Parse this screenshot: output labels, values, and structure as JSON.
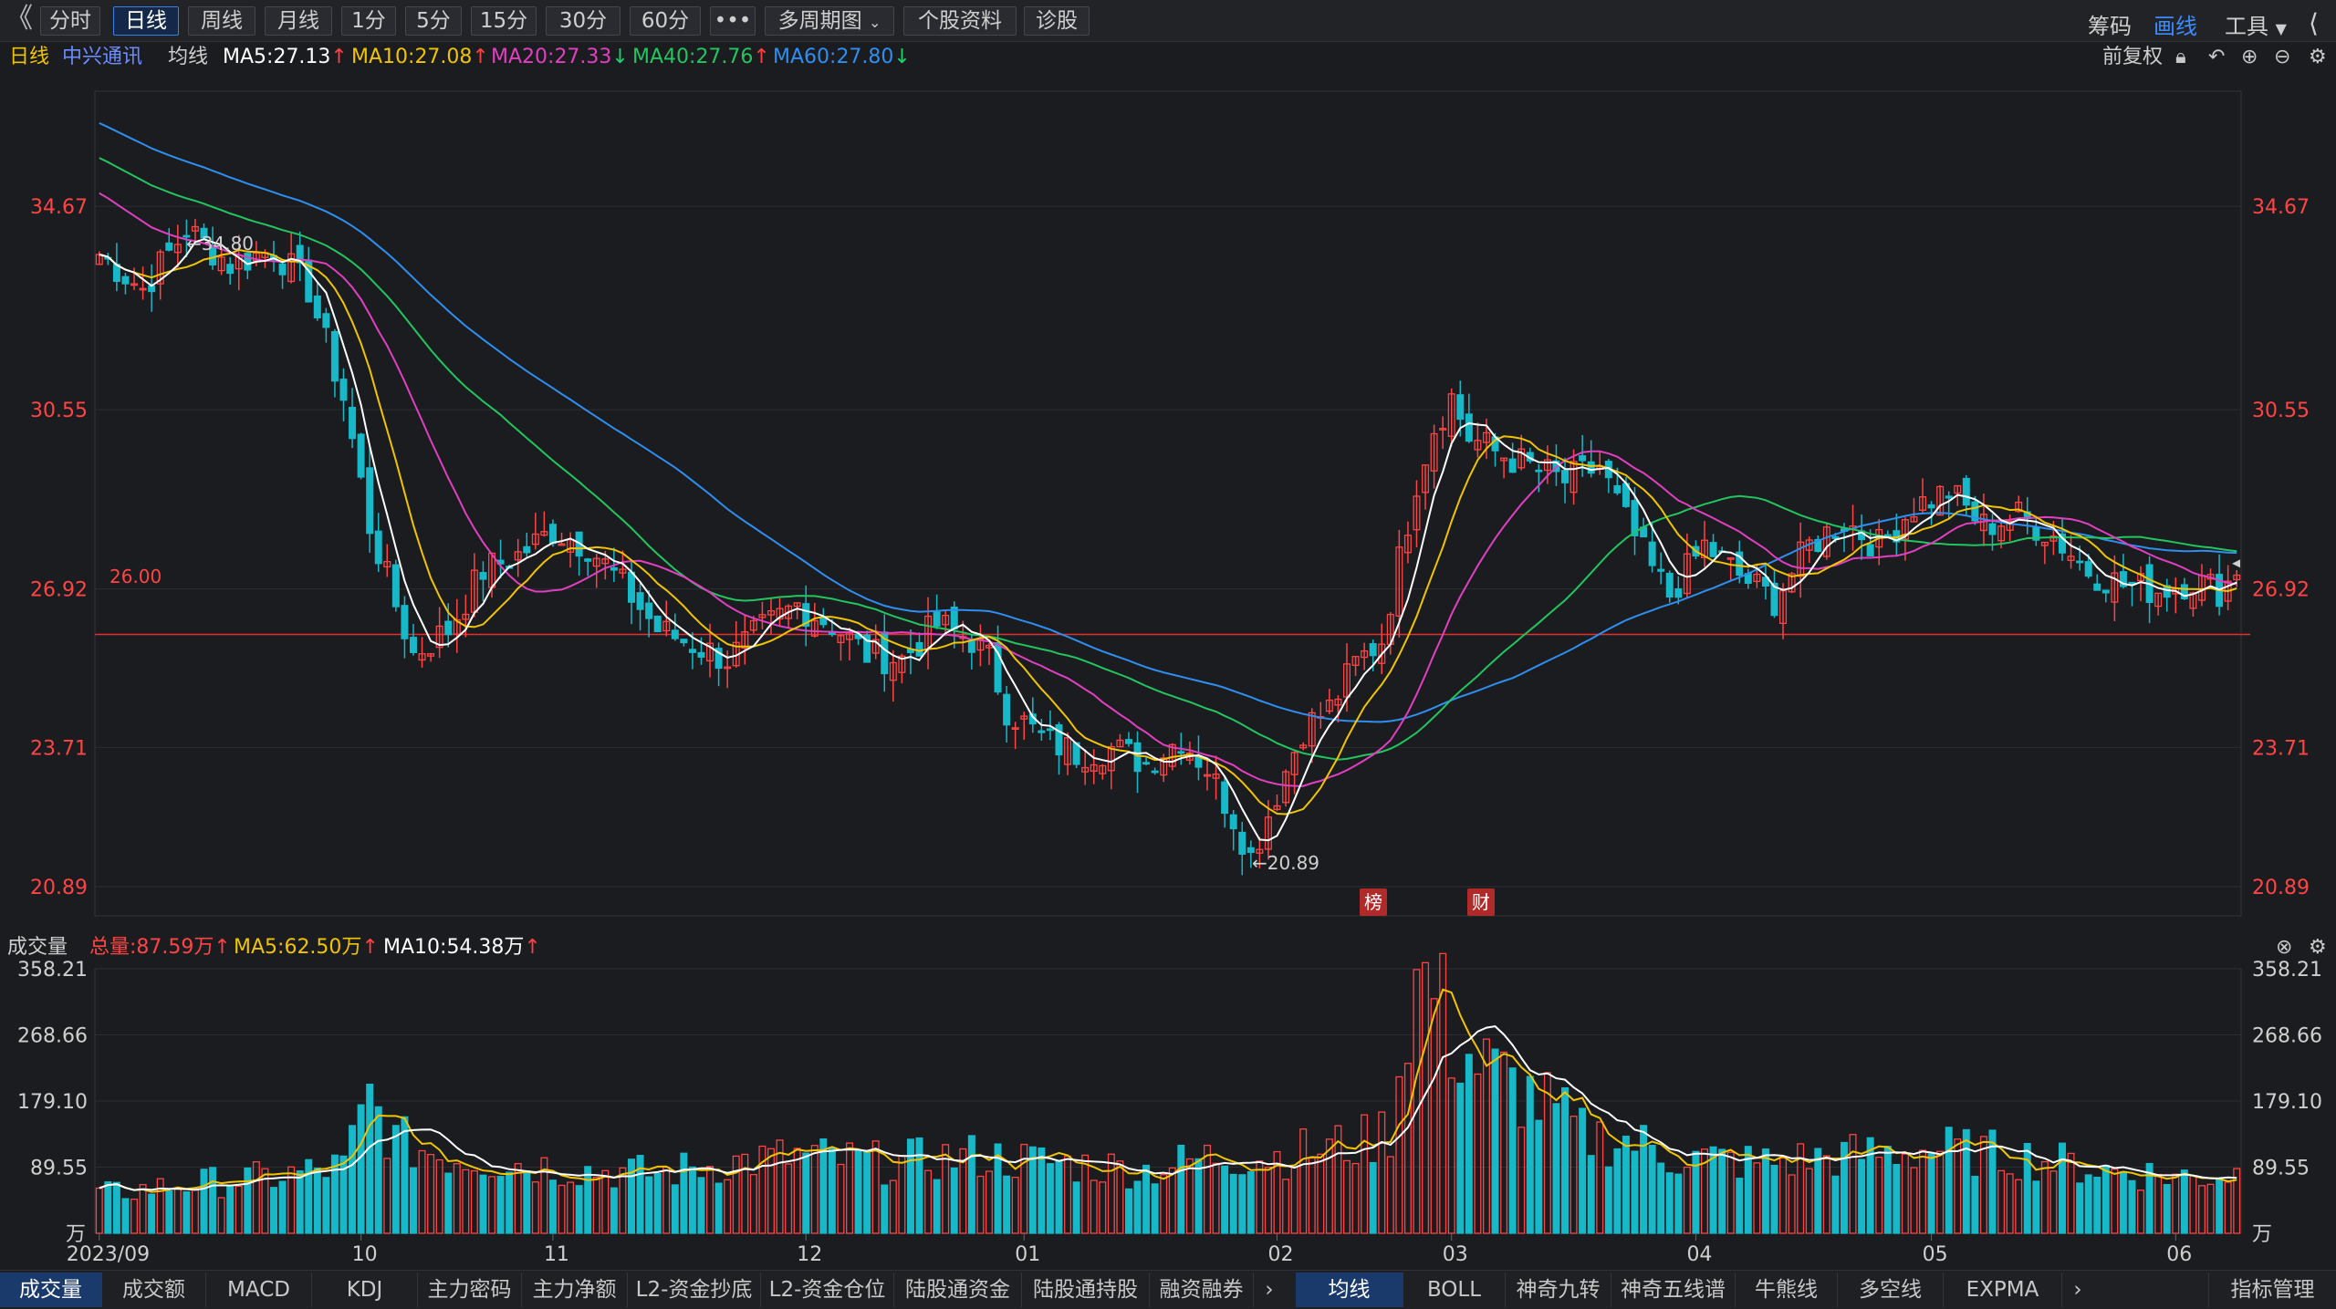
{
  "toolbar": {
    "back_label": "《",
    "periods": [
      "分时",
      "日线",
      "周线",
      "月线",
      "1分",
      "5分",
      "15分",
      "30分",
      "60分"
    ],
    "more": "•••",
    "multi_period": "多周期图",
    "profile": "个股资料",
    "diagnose": "诊股",
    "right": [
      "筹码",
      "画线",
      "工具"
    ]
  },
  "legend": {
    "period": "日线",
    "stock": "中兴通讯",
    "ma_label": "均线",
    "ma5": "MA5:27.13",
    "ma10": "MA10:27.08",
    "ma20": "MA20:27.33",
    "ma40": "MA40:27.76",
    "ma60": "MA60:27.80",
    "adjust": "前复权"
  },
  "volume_legend": {
    "title": "成交量",
    "total": "总量:87.59万",
    "ma5": "MA5:62.50万",
    "ma10": "MA10:54.38万"
  },
  "annotations": {
    "high": "←34.80",
    "low": "←20.89",
    "line_price": "26.00",
    "tag1": "榜",
    "tag2": "财"
  },
  "colors": {
    "up": "#ff4444",
    "down": "#17b8c8",
    "ma5": "#ffffff",
    "ma10": "#f0c400",
    "ma20": "#e040c0",
    "ma40": "#22c55e",
    "ma60": "#2e8ff0"
  },
  "bottom_tabs": {
    "left": [
      "成交量",
      "成交额",
      "MACD",
      "KDJ",
      "主力密码",
      "主力净额",
      "L2-资金抄底",
      "L2-资金仓位",
      "陆股通资金",
      "陆股通持股",
      "融资融券"
    ],
    "right": [
      "均线",
      "BOLL",
      "神奇九转",
      "神奇五线谱",
      "牛熊线",
      "多空线",
      "EXPMA"
    ],
    "manage": "指标管理"
  },
  "chart_data": [
    {
      "type": "candlestick",
      "title": "中兴通讯 日线",
      "y_ticks": [
        "34.67",
        "30.55",
        "26.92",
        "23.71",
        "20.89"
      ],
      "y_tick_values": [
        34.67,
        30.55,
        26.92,
        23.71,
        20.89
      ],
      "x_ticks": [
        "2023/09",
        "10",
        "11",
        "12",
        "01",
        "02",
        "03",
        "04",
        "05",
        "06"
      ],
      "ylim": [
        20.3,
        37.0
      ],
      "high": 34.8,
      "low": 20.89,
      "horizontal_line": 26.0,
      "moving_averages": [
        "MA5",
        "MA10",
        "MA20",
        "MA40",
        "MA60"
      ],
      "close_anchors": [
        [
          0,
          33.7
        ],
        [
          5,
          33.0
        ],
        [
          10,
          34.2
        ],
        [
          15,
          33.5
        ],
        [
          20,
          33.8
        ],
        [
          24,
          33.0
        ],
        [
          28,
          30.8
        ],
        [
          31,
          28.2
        ],
        [
          34,
          26.6
        ],
        [
          36,
          25.6
        ],
        [
          40,
          26.1
        ],
        [
          44,
          27.3
        ],
        [
          48,
          27.6
        ],
        [
          52,
          28.1
        ],
        [
          56,
          27.8
        ],
        [
          60,
          27.0
        ],
        [
          64,
          26.1
        ],
        [
          68,
          25.8
        ],
        [
          72,
          25.5
        ],
        [
          76,
          26.1
        ],
        [
          80,
          26.6
        ],
        [
          84,
          26.2
        ],
        [
          88,
          25.6
        ],
        [
          92,
          25.5
        ],
        [
          96,
          26.2
        ],
        [
          100,
          25.9
        ],
        [
          102,
          25.5
        ],
        [
          104,
          24.5
        ],
        [
          108,
          23.9
        ],
        [
          112,
          23.6
        ],
        [
          116,
          23.7
        ],
        [
          120,
          23.4
        ],
        [
          124,
          23.9
        ],
        [
          127,
          23.3
        ],
        [
          130,
          22.3
        ],
        [
          132,
          21.5
        ],
        [
          135,
          22.8
        ],
        [
          138,
          24.1
        ],
        [
          141,
          24.5
        ],
        [
          144,
          25.4
        ],
        [
          147,
          25.9
        ],
        [
          149,
          27.5
        ],
        [
          151,
          29.1
        ],
        [
          153,
          30.2
        ],
        [
          155,
          30.8
        ],
        [
          157,
          30.0
        ],
        [
          160,
          29.7
        ],
        [
          164,
          29.4
        ],
        [
          168,
          29.1
        ],
        [
          172,
          29.4
        ],
        [
          175,
          28.3
        ],
        [
          178,
          27.3
        ],
        [
          180,
          26.8
        ],
        [
          184,
          27.8
        ],
        [
          188,
          27.2
        ],
        [
          192,
          26.7
        ],
        [
          196,
          27.8
        ],
        [
          200,
          28.3
        ],
        [
          204,
          27.8
        ],
        [
          208,
          28.6
        ],
        [
          212,
          28.9
        ],
        [
          216,
          28.2
        ],
        [
          220,
          28.4
        ],
        [
          224,
          28.0
        ],
        [
          228,
          27.3
        ],
        [
          232,
          27.0
        ],
        [
          236,
          26.9
        ],
        [
          240,
          27.1
        ],
        [
          243,
          26.9
        ],
        [
          245,
          27.2
        ]
      ]
    },
    {
      "type": "bar",
      "title": "成交量",
      "unit": "万",
      "y_ticks": [
        "358.21",
        "268.66",
        "179.10",
        "89.55"
      ],
      "y_tick_values": [
        358.21,
        268.66,
        179.1,
        89.55
      ],
      "ylim": [
        0,
        358.21
      ],
      "total": 87.59,
      "ma5": 62.5,
      "ma10": 54.38,
      "volume_anchors": [
        [
          0,
          55
        ],
        [
          10,
          70
        ],
        [
          20,
          80
        ],
        [
          28,
          95
        ],
        [
          31,
          190
        ],
        [
          34,
          130
        ],
        [
          40,
          110
        ],
        [
          48,
          100
        ],
        [
          56,
          90
        ],
        [
          64,
          85
        ],
        [
          72,
          100
        ],
        [
          80,
          110
        ],
        [
          90,
          100
        ],
        [
          100,
          110
        ],
        [
          110,
          100
        ],
        [
          120,
          90
        ],
        [
          128,
          110
        ],
        [
          135,
          110
        ],
        [
          140,
          120
        ],
        [
          145,
          130
        ],
        [
          148,
          150
        ],
        [
          150,
          320
        ],
        [
          151,
          358
        ],
        [
          153,
          350
        ],
        [
          155,
          280
        ],
        [
          158,
          240
        ],
        [
          162,
          210
        ],
        [
          166,
          180
        ],
        [
          170,
          140
        ],
        [
          176,
          130
        ],
        [
          180,
          110
        ],
        [
          190,
          100
        ],
        [
          200,
          110
        ],
        [
          210,
          120
        ],
        [
          220,
          110
        ],
        [
          230,
          90
        ],
        [
          240,
          80
        ],
        [
          245,
          87.59
        ]
      ]
    }
  ]
}
